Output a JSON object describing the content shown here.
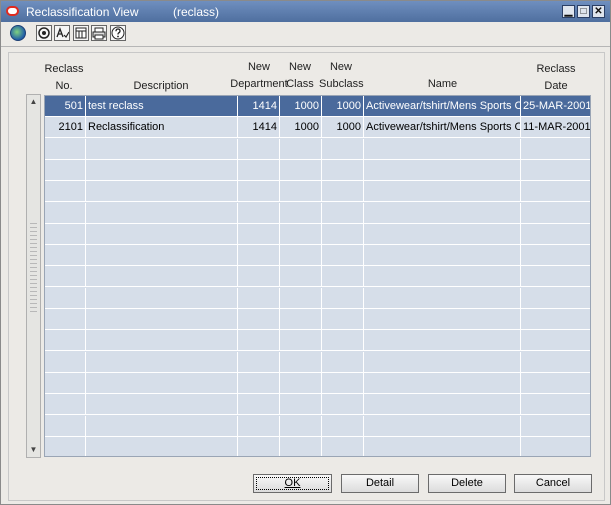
{
  "window": {
    "title": "Reclassification View",
    "subtitle": "(reclass)",
    "controls": {
      "minimize": "▁",
      "maximize": "□",
      "close": "✕"
    }
  },
  "toolbar": {
    "icons": [
      "globe-icon",
      "notes-icon",
      "spell-icon",
      "calendar-icon",
      "print-icon",
      "help-icon"
    ]
  },
  "table": {
    "headers": {
      "reclass_no": [
        "Reclass",
        "No."
      ],
      "description": [
        "Description"
      ],
      "new_department": [
        "New",
        "Department"
      ],
      "new_class": [
        "New",
        "Class"
      ],
      "new_subclass": [
        "New",
        "Subclass"
      ],
      "name": [
        "Name"
      ],
      "reclass_date": [
        "Reclass",
        "Date"
      ]
    },
    "rows": [
      {
        "reclass_no": "501",
        "description": "test reclass",
        "new_department": "1414",
        "new_class": "1000",
        "new_subclass": "1000",
        "name": "Activewear/tshirt/Mens Sports Coats",
        "reclass_date": "25-MAR-2001",
        "selected": true
      },
      {
        "reclass_no": "2101",
        "description": "Reclassification",
        "new_department": "1414",
        "new_class": "1000",
        "new_subclass": "1000",
        "name": "Activewear/tshirt/Mens Sports Coats",
        "reclass_date": "11-MAR-2001",
        "selected": false
      }
    ],
    "empty_rows": 15
  },
  "buttons": {
    "ok": "OK",
    "detail": "Detail",
    "delete": "Delete",
    "cancel": "Cancel"
  },
  "colors": {
    "titlebar": "#5a7aab",
    "selected_row": "#4a6a9c",
    "grid_bg": "#d6dee9"
  }
}
